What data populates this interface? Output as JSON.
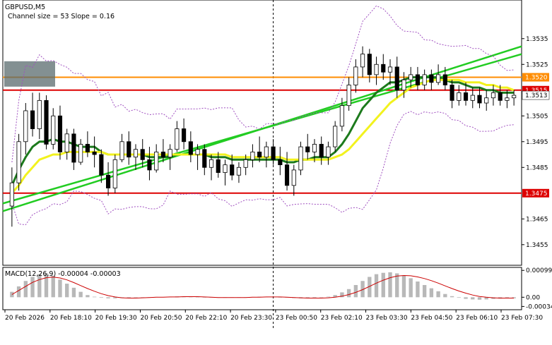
{
  "header": {
    "symbol": "GBPUSD,M5",
    "channel_info": "Channel size = 53 Slope = 0.16",
    "macd_label": "MACD(12,26,9) -0.00004 -0.00003"
  },
  "chart_data": [
    {
      "type": "candlestick",
      "title": "GBPUSD,M5",
      "ylim": [
        1.3447,
        1.355
      ],
      "y_ticks": [
        "1.3535",
        "1.3525",
        "1.3505",
        "1.3495",
        "1.3485",
        "1.3465",
        "1.3455"
      ],
      "x_ticks": [
        "20 Feb 2026",
        "20 Feb 18:10",
        "20 Feb 19:30",
        "20 Feb 20:50",
        "20 Feb 22:10",
        "20 Feb 23:30",
        "23 Feb 00:50",
        "23 Feb 02:10",
        "23 Feb 03:30",
        "23 Feb 04:50",
        "23 Feb 06:10",
        "23 Feb 07:30"
      ],
      "ohlc": [
        [
          1.347,
          1.3485,
          1.3462,
          1.3479
        ],
        [
          1.3479,
          1.3498,
          1.3476,
          1.3495
        ],
        [
          1.3495,
          1.351,
          1.349,
          1.3507
        ],
        [
          1.3507,
          1.3514,
          1.3497,
          1.35
        ],
        [
          1.35,
          1.3514,
          1.3496,
          1.3511
        ],
        [
          1.3511,
          1.3513,
          1.3492,
          1.3494
        ],
        [
          1.3494,
          1.3508,
          1.3492,
          1.3505
        ],
        [
          1.3505,
          1.3509,
          1.3488,
          1.3491
        ],
        [
          1.3491,
          1.35,
          1.3488,
          1.3498
        ],
        [
          1.3498,
          1.35,
          1.3484,
          1.3487
        ],
        [
          1.3487,
          1.3496,
          1.3486,
          1.3494
        ],
        [
          1.3494,
          1.3499,
          1.3489,
          1.3491
        ],
        [
          1.3491,
          1.3497,
          1.3485,
          1.349
        ],
        [
          1.349,
          1.3492,
          1.3479,
          1.3482
        ],
        [
          1.3482,
          1.3487,
          1.3474,
          1.3477
        ],
        [
          1.3477,
          1.349,
          1.3475,
          1.3488
        ],
        [
          1.3488,
          1.3498,
          1.3487,
          1.3495
        ],
        [
          1.3495,
          1.3499,
          1.3486,
          1.3489
        ],
        [
          1.3489,
          1.3494,
          1.3484,
          1.3492
        ],
        [
          1.3492,
          1.3496,
          1.3485,
          1.3488
        ],
        [
          1.3488,
          1.3493,
          1.348,
          1.3484
        ],
        [
          1.3484,
          1.3494,
          1.3483,
          1.3491
        ],
        [
          1.3491,
          1.3496,
          1.3487,
          1.3489
        ],
        [
          1.3489,
          1.3494,
          1.3484,
          1.3492
        ],
        [
          1.3492,
          1.3503,
          1.3491,
          1.35
        ],
        [
          1.35,
          1.3504,
          1.3492,
          1.3495
        ],
        [
          1.3495,
          1.3499,
          1.3487,
          1.349
        ],
        [
          1.349,
          1.3494,
          1.3484,
          1.3492
        ],
        [
          1.3492,
          1.3494,
          1.3482,
          1.3485
        ],
        [
          1.3485,
          1.349,
          1.348,
          1.3488
        ],
        [
          1.3488,
          1.3491,
          1.3481,
          1.3483
        ],
        [
          1.3483,
          1.3488,
          1.3478,
          1.3486
        ],
        [
          1.3486,
          1.349,
          1.348,
          1.3482
        ],
        [
          1.3482,
          1.3487,
          1.3479,
          1.3485
        ],
        [
          1.3485,
          1.349,
          1.3482,
          1.3488
        ],
        [
          1.3488,
          1.3494,
          1.3485,
          1.3491
        ],
        [
          1.3491,
          1.3497,
          1.3487,
          1.3489
        ],
        [
          1.3489,
          1.3495,
          1.3485,
          1.3493
        ],
        [
          1.3493,
          1.3496,
          1.3486,
          1.3488
        ],
        [
          1.3488,
          1.3493,
          1.3482,
          1.3486
        ],
        [
          1.3486,
          1.3491,
          1.3476,
          1.3478
        ],
        [
          1.3478,
          1.3486,
          1.3474,
          1.3484
        ],
        [
          1.3484,
          1.3495,
          1.3482,
          1.3493
        ],
        [
          1.3493,
          1.3498,
          1.3488,
          1.3491
        ],
        [
          1.3491,
          1.3496,
          1.3487,
          1.3494
        ],
        [
          1.3494,
          1.3497,
          1.3486,
          1.3489
        ],
        [
          1.3489,
          1.3495,
          1.3486,
          1.3493
        ],
        [
          1.3493,
          1.3503,
          1.3491,
          1.3501
        ],
        [
          1.3501,
          1.3512,
          1.3499,
          1.3509
        ],
        [
          1.3509,
          1.352,
          1.3507,
          1.3517
        ],
        [
          1.3517,
          1.3527,
          1.3514,
          1.3524
        ],
        [
          1.3524,
          1.3532,
          1.352,
          1.3529
        ],
        [
          1.3529,
          1.3531,
          1.3518,
          1.3521
        ],
        [
          1.3521,
          1.3528,
          1.3517,
          1.3525
        ],
        [
          1.3525,
          1.3529,
          1.3519,
          1.3522
        ],
        [
          1.3522,
          1.3527,
          1.3517,
          1.3524
        ],
        [
          1.3524,
          1.3528,
          1.3512,
          1.3515
        ],
        [
          1.3515,
          1.3522,
          1.3512,
          1.3519
        ],
        [
          1.3519,
          1.3524,
          1.3516,
          1.3521
        ],
        [
          1.3521,
          1.3524,
          1.3515,
          1.3517
        ],
        [
          1.3517,
          1.3523,
          1.3515,
          1.3521
        ],
        [
          1.3521,
          1.3523,
          1.3515,
          1.3518
        ],
        [
          1.3518,
          1.3525,
          1.3517,
          1.3521
        ],
        [
          1.3521,
          1.3524,
          1.3515,
          1.3517
        ],
        [
          1.3517,
          1.3519,
          1.3508,
          1.3511
        ],
        [
          1.3511,
          1.3517,
          1.3509,
          1.3514
        ],
        [
          1.3514,
          1.3518,
          1.3509,
          1.3511
        ],
        [
          1.3511,
          1.3516,
          1.3508,
          1.3513
        ],
        [
          1.3513,
          1.3516,
          1.3508,
          1.351
        ],
        [
          1.351,
          1.3515,
          1.3507,
          1.3512
        ],
        [
          1.3512,
          1.3517,
          1.3509,
          1.3514
        ],
        [
          1.3514,
          1.3517,
          1.3509,
          1.3511
        ],
        [
          1.3511,
          1.3515,
          1.3508,
          1.3512
        ],
        [
          1.3512,
          1.3515,
          1.3509,
          1.3513
        ]
      ],
      "series": [
        {
          "name": "",
          "color": "#1c7a1c",
          "values": [
            1.3478,
            1.3484,
            1.3489,
            1.3493,
            1.3495,
            1.3495,
            1.3496,
            1.3495,
            1.3495,
            1.3494,
            1.3493,
            1.3493,
            1.3493,
            1.3491,
            1.349,
            1.349,
            1.349,
            1.349,
            1.349,
            1.349,
            1.3489,
            1.3489,
            1.3489,
            1.3489,
            1.349,
            1.349,
            1.349,
            1.349,
            1.349,
            1.3489,
            1.3489,
            1.3489,
            1.3488,
            1.3488,
            1.3488,
            1.3488,
            1.3488,
            1.3488,
            1.3488,
            1.3488,
            1.3487,
            1.3487,
            1.3488,
            1.3488,
            1.3489,
            1.3489,
            1.3489,
            1.3491,
            1.3494,
            1.3498,
            1.3503,
            1.3508,
            1.3511,
            1.3514,
            1.3516,
            1.3518,
            1.3518,
            1.3519,
            1.352,
            1.352,
            1.352,
            1.352,
            1.352,
            1.3519,
            1.3518,
            1.3518,
            1.3517,
            1.3516,
            1.3516,
            1.3515,
            1.3515,
            1.3514,
            1.3514,
            1.3514
          ]
        },
        {
          "name": "",
          "color": "#f2f21e",
          "values": [
            1.3475,
            1.3478,
            1.3482,
            1.3485,
            1.3488,
            1.3489,
            1.349,
            1.349,
            1.3491,
            1.3491,
            1.3491,
            1.3491,
            1.3491,
            1.3491,
            1.349,
            1.349,
            1.349,
            1.349,
            1.349,
            1.349,
            1.349,
            1.349,
            1.349,
            1.349,
            1.349,
            1.349,
            1.349,
            1.349,
            1.349,
            1.349,
            1.349,
            1.349,
            1.3489,
            1.3489,
            1.3489,
            1.3489,
            1.3489,
            1.3489,
            1.3489,
            1.3489,
            1.3488,
            1.3488,
            1.3488,
            1.3488,
            1.3488,
            1.3488,
            1.3488,
            1.3489,
            1.349,
            1.3492,
            1.3495,
            1.3498,
            1.3501,
            1.3504,
            1.3507,
            1.351,
            1.3512,
            1.3514,
            1.3516,
            1.3517,
            1.3518,
            1.3519,
            1.3519,
            1.3519,
            1.3519,
            1.3519,
            1.3518,
            1.3518,
            1.3518,
            1.3517,
            1.3517,
            1.3516,
            1.3516,
            1.3515
          ]
        }
      ],
      "channel_lines": [
        {
          "color": "#22cc22",
          "from": [
            0,
            1.3471
          ],
          "to": [
            100,
            1.3529
          ]
        },
        {
          "color": "#22cc22",
          "from": [
            0,
            1.3468
          ],
          "to": [
            100,
            1.3532
          ]
        }
      ],
      "horizontal_levels": [
        {
          "label": "1.3520",
          "value": 1.352,
          "color": "#ff8c00"
        },
        {
          "label": "1.3515",
          "value": 1.3515,
          "color": "#dd0000"
        },
        {
          "label": "1.3475",
          "value": 1.3475,
          "color": "#dd0000"
        }
      ],
      "current_price_label": "1.3513"
    },
    {
      "type": "macd",
      "title": "MACD(12,26,9) -0.00004 -0.00003",
      "ylim": [
        -0.00046,
        0.0011
      ],
      "y_ticks": [
        "0.00099",
        "0.00",
        "-0.00034"
      ],
      "histogram": [
        0.0002,
        0.0004,
        0.0006,
        0.00075,
        0.00085,
        0.00088,
        0.0008,
        0.00065,
        0.0005,
        0.00035,
        0.0002,
        8e-05,
        2e-05,
        -2e-05,
        -4e-05,
        -4e-05,
        -3e-05,
        -2e-05,
        -1e-05,
        0.0,
        0.0,
        1e-05,
        1e-05,
        2e-05,
        3e-05,
        3e-05,
        2e-05,
        1e-05,
        0.0,
        -1e-05,
        -2e-05,
        -2e-05,
        -1e-05,
        0.0,
        0.0,
        1e-05,
        2e-05,
        2e-05,
        1e-05,
        0.0,
        -1e-05,
        -3e-05,
        -4e-05,
        -4e-05,
        -3e-05,
        -1e-05,
        2e-05,
        8e-05,
        0.00018,
        0.0003,
        0.00045,
        0.0006,
        0.00075,
        0.00085,
        0.0009,
        0.00092,
        0.00088,
        0.0008,
        0.0007,
        0.00058,
        0.00045,
        0.00033,
        0.00022,
        0.00012,
        4e-05,
        -2e-05,
        -6e-05,
        -8e-05,
        -9e-05,
        -8e-05,
        -6e-05,
        -5e-05,
        -4e-05,
        -4e-05
      ],
      "signal": [
        0.0001,
        0.00025,
        0.0004,
        0.00055,
        0.00065,
        0.00072,
        0.00074,
        0.00071,
        0.00064,
        0.00054,
        0.00043,
        0.00032,
        0.00022,
        0.00013,
        6e-05,
        1e-05,
        -2e-05,
        -3e-05,
        -3e-05,
        -2e-05,
        -1e-05,
        0.0,
        0.0,
        1e-05,
        1e-05,
        2e-05,
        2e-05,
        2e-05,
        1e-05,
        0.0,
        -1e-05,
        -1e-05,
        -1e-05,
        -1e-05,
        -1e-05,
        0.0,
        0.0,
        1e-05,
        1e-05,
        1e-05,
        0.0,
        -1e-05,
        -2e-05,
        -3e-05,
        -3e-05,
        -3e-05,
        -2e-05,
        0.0,
        4e-05,
        0.0001,
        0.00018,
        0.00028,
        0.0004,
        0.00052,
        0.00063,
        0.00072,
        0.00078,
        0.0008,
        0.00079,
        0.00075,
        0.00069,
        0.00061,
        0.00052,
        0.00042,
        0.00032,
        0.00023,
        0.00015,
        8e-05,
        3e-05,
        0.0,
        -2e-05,
        -3e-05,
        -3e-05,
        -3e-05
      ]
    }
  ]
}
